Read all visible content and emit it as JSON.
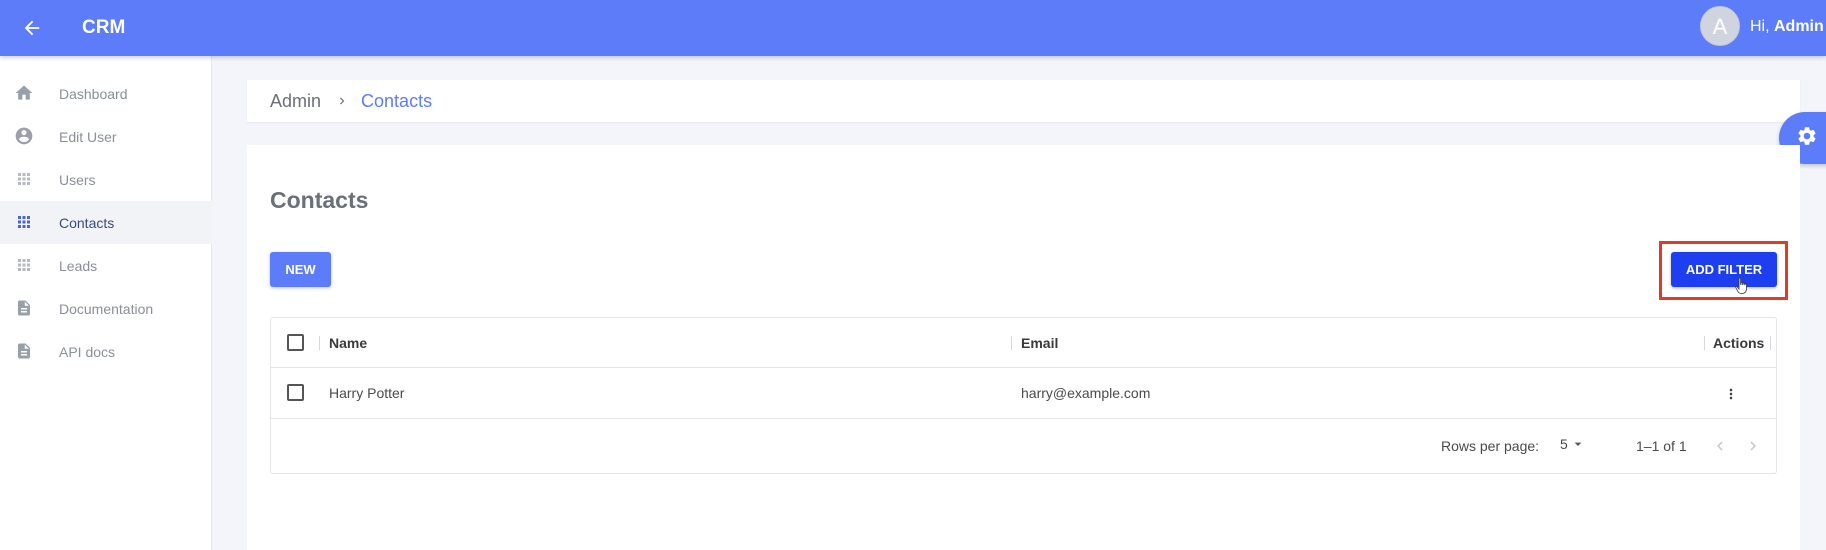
{
  "header": {
    "app_title": "CRM",
    "avatar_initial": "A",
    "greeting_prefix": "Hi, ",
    "greeting_user": "Admin",
    "brand_color": "#5c7cfa"
  },
  "sidebar": {
    "items": [
      {
        "label": "Dashboard",
        "icon": "home-icon"
      },
      {
        "label": "Edit User",
        "icon": "account-circle-icon"
      },
      {
        "label": "Users",
        "icon": "grid-icon"
      },
      {
        "label": "Contacts",
        "icon": "grid-icon",
        "active": true
      },
      {
        "label": "Leads",
        "icon": "grid-icon"
      },
      {
        "label": "Documentation",
        "icon": "document-icon"
      },
      {
        "label": "API docs",
        "icon": "document-icon"
      }
    ]
  },
  "breadcrumb": {
    "root": "Admin",
    "current": "Contacts"
  },
  "page": {
    "title": "Contacts",
    "new_button": "NEW",
    "filter_button": "ADD FILTER",
    "highlight_color": "#e03a2a"
  },
  "table": {
    "columns": [
      "Name",
      "Email",
      "Actions"
    ],
    "rows": [
      {
        "name": "Harry Potter",
        "email": "harry@example.com"
      }
    ],
    "footer": {
      "rows_per_page_label": "Rows per page:",
      "rows_per_page_value": "5",
      "range": "1–1 of 1"
    }
  }
}
